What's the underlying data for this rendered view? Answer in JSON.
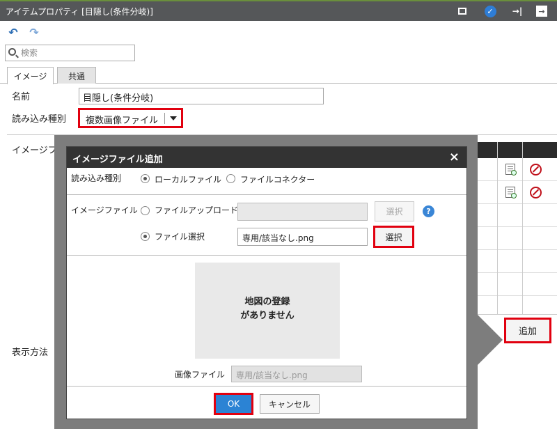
{
  "window": {
    "title": "アイテムプロパティ [目隠し(条件分岐)]",
    "icons": [
      "window-icon",
      "check-icon",
      "pin-icon",
      "exit-icon"
    ]
  },
  "toolbar": {
    "undo_icon": "undo-icon",
    "redo_icon": "redo-icon"
  },
  "search": {
    "placeholder": "検索"
  },
  "tabs": [
    {
      "label": "イメージ",
      "active": true
    },
    {
      "label": "共通",
      "active": false
    }
  ],
  "form": {
    "name_label": "名前",
    "name_value": "目隠し(条件分岐)",
    "load_type_label": "読み込み種別",
    "load_type_value": "複数画像ファイル",
    "image_file_label": "イメージファ",
    "display_method_label": "表示方法",
    "add_button": "追加"
  },
  "dialog": {
    "title": "イメージファイル追加",
    "close": "×",
    "load_type_label": "読み込み種別",
    "radio_local": "ローカルファイル",
    "radio_connector": "ファイルコネクター",
    "image_file_label": "イメージファイル",
    "radio_upload": "ファイルアップロード",
    "select_disabled": "選択",
    "help": "?",
    "radio_file_select": "ファイル選択",
    "file_value": "専用/該当なし.png",
    "select_button": "選択",
    "preview_line1": "地図の登録",
    "preview_line2": "がありません",
    "image_file_field_label": "画像ファイル",
    "image_file_field_value": "専用/該当なし.png",
    "ok": "OK",
    "cancel": "キャンセル"
  },
  "colors": {
    "titlebar": "#555759",
    "highlight": "#e1000f",
    "ok_button": "#2b83d4"
  }
}
